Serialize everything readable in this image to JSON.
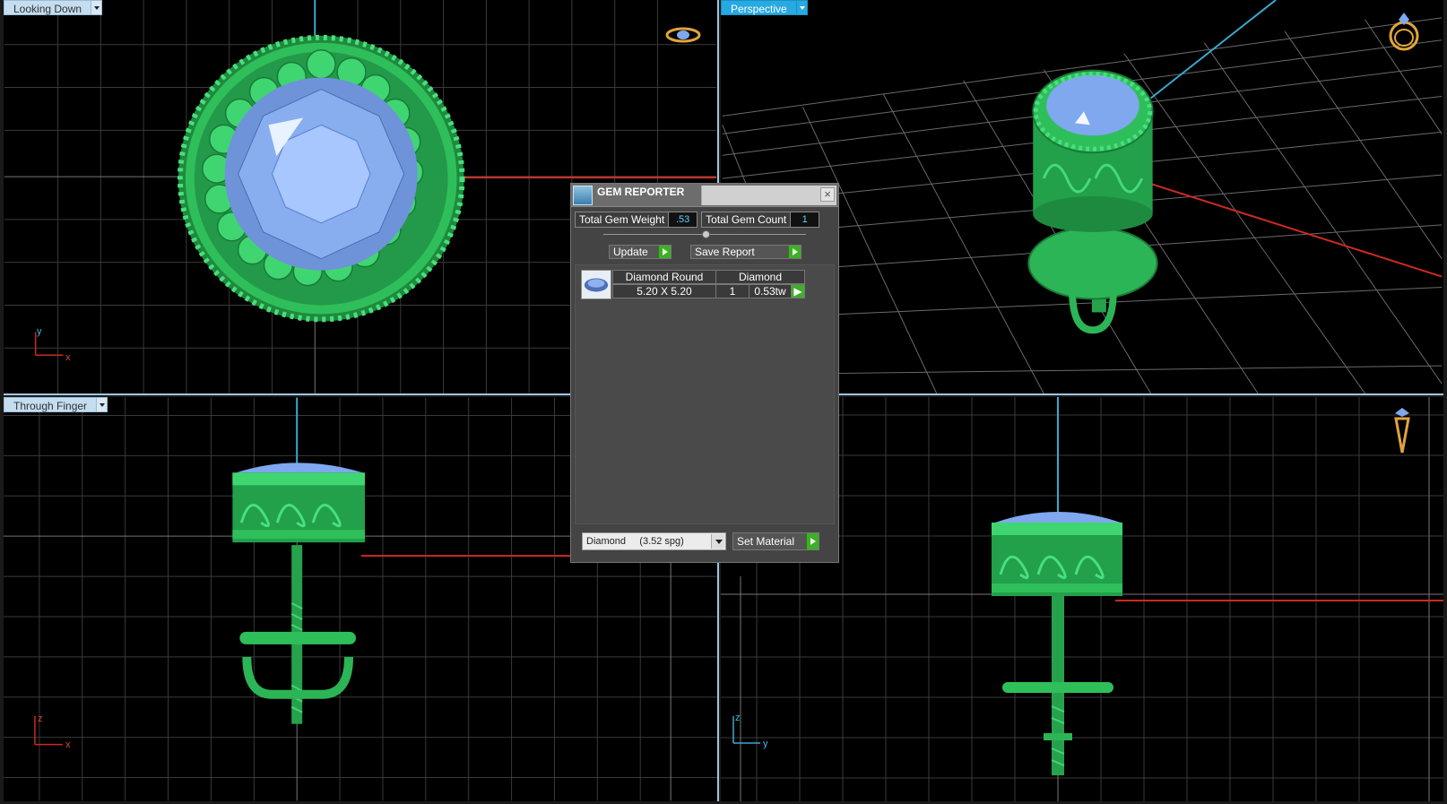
{
  "viewports": {
    "top": {
      "label": "Looking Down",
      "axis_h": "x",
      "axis_v": "y"
    },
    "perspective": {
      "label": "Perspective"
    },
    "front": {
      "label": "Through Finger",
      "axis_h": "x",
      "axis_v": "z"
    },
    "side": {
      "label": "",
      "axis_h": "y",
      "axis_v": "z"
    }
  },
  "icons": {
    "view_cube_top": "ring-top-view-icon",
    "view_cube_persp": "ring-perspective-icon",
    "view_cube_side": "ring-side-view-icon"
  },
  "gem_reporter": {
    "title": "GEM REPORTER",
    "close_glyph": "×",
    "total_weight_label": "Total Gem Weight",
    "total_weight_value": ".53",
    "total_count_label": "Total Gem Count",
    "total_count_value": "1",
    "update_label": "Update",
    "save_report_label": "Save Report",
    "gems": [
      {
        "shape": "Diamond Round",
        "material": "Diamond",
        "size": "5.20 X 5.20",
        "count": "1",
        "weight": "0.53tw"
      }
    ],
    "material_select": "Diamond     (3.52 spg)",
    "set_material_label": "Set Material"
  },
  "colors": {
    "accent": "#27a9e1",
    "model_green": "#2fbf5a",
    "gem_blue": "#7fa8ef",
    "axis_red": "#cc2a20",
    "axis_cyan": "#3aa8d0"
  }
}
